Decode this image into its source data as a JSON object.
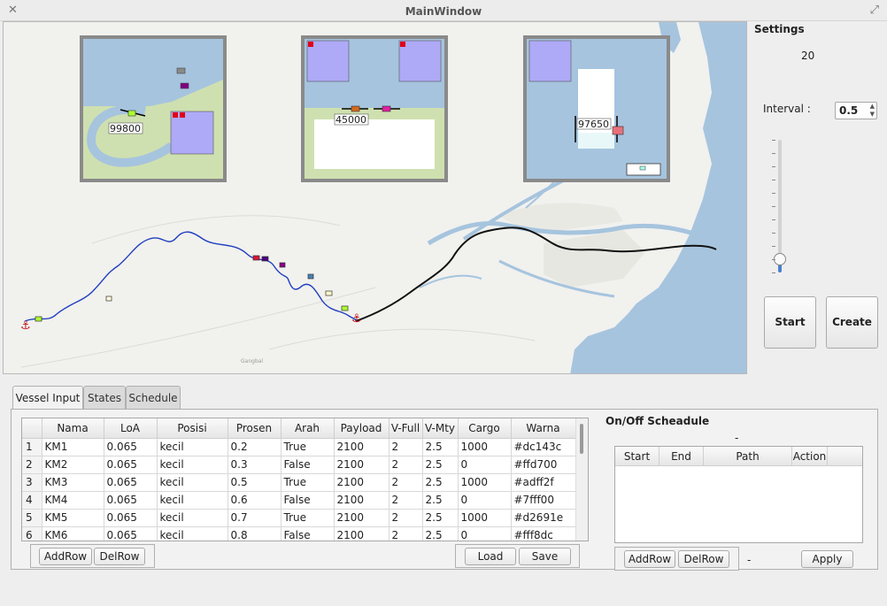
{
  "window": {
    "title": "MainWindow"
  },
  "map": {
    "insets": [
      {
        "label": "99800"
      },
      {
        "label": "45000"
      },
      {
        "label": "97650"
      }
    ],
    "place_label": "Gangbal"
  },
  "settings": {
    "title": "Settings",
    "value": "20",
    "interval_label": "Interval :",
    "interval_value": "0.5",
    "slider_level": 0.06,
    "start_label": "Start",
    "create_label": "Create"
  },
  "tabs": [
    {
      "label": "Vessel Input",
      "active": true
    },
    {
      "label": "States",
      "active": false
    },
    {
      "label": "Schedule",
      "active": false
    }
  ],
  "vessel_table": {
    "columns": [
      "Nama",
      "LoA",
      "Posisi",
      "Prosen",
      "Arah",
      "Payload",
      "V-Full",
      "V-Mty",
      "Cargo",
      "Warna"
    ],
    "rows": [
      {
        "n": "1",
        "cells": [
          "KM1",
          "0.065",
          "kecil",
          "0.2",
          "True",
          "2100",
          "2",
          "2.5",
          "1000",
          "#dc143c"
        ]
      },
      {
        "n": "2",
        "cells": [
          "KM2",
          "0.065",
          "kecil",
          "0.3",
          "False",
          "2100",
          "2",
          "2.5",
          "0",
          "#ffd700"
        ]
      },
      {
        "n": "3",
        "cells": [
          "KM3",
          "0.065",
          "kecil",
          "0.5",
          "True",
          "2100",
          "2",
          "2.5",
          "1000",
          "#adff2f"
        ]
      },
      {
        "n": "4",
        "cells": [
          "KM4",
          "0.065",
          "kecil",
          "0.6",
          "False",
          "2100",
          "2",
          "2.5",
          "0",
          "#7fff00"
        ]
      },
      {
        "n": "5",
        "cells": [
          "KM5",
          "0.065",
          "kecil",
          "0.7",
          "True",
          "2100",
          "2",
          "2.5",
          "1000",
          "#d2691e"
        ]
      },
      {
        "n": "6",
        "cells": [
          "KM6",
          "0.065",
          "kecil",
          "0.8",
          "False",
          "2100",
          "2",
          "2.5",
          "0",
          "#fff8dc"
        ]
      }
    ],
    "add_row": "AddRow",
    "del_row": "DelRow",
    "load": "Load",
    "save": "Save"
  },
  "onoff": {
    "title": "On/Off Scheadule",
    "dash_top": "-",
    "columns": [
      "Start",
      "End",
      "Path",
      "Action"
    ],
    "add_row": "AddRow",
    "del_row": "DelRow",
    "dash_bottom": "-",
    "apply": "Apply"
  }
}
